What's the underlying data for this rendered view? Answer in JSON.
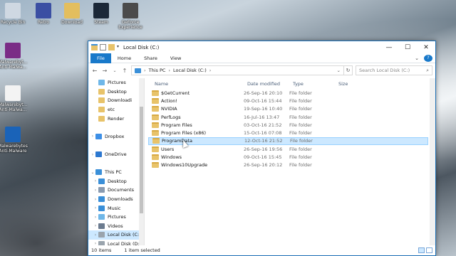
{
  "desktop": {
    "icons": [
      {
        "label": "Recycle Bin",
        "icon": "recycle-bin-icon",
        "color": "#cfd8e2"
      },
      {
        "label": "Retro",
        "icon": "retro-icon",
        "color": "#3b4fa3"
      },
      {
        "label": "Download",
        "icon": "folder-icon",
        "color": "#e3be5e"
      },
      {
        "label": "Steam",
        "icon": "steam-icon",
        "color": "#1b2838"
      },
      {
        "label": "GeForce Experience",
        "icon": "geforce-icon",
        "color": "#4b4b4b"
      },
      {
        "label": "Malwarebyt... Anti-Malwa...",
        "icon": "winrar-icon",
        "color": "#7a2c86"
      },
      {
        "label": "Malwarebyt... Anti-Malwa...",
        "icon": "document-icon",
        "color": "#f3f3f3"
      },
      {
        "label": "Malwarebytes Anti-Malware",
        "icon": "malwarebytes-icon",
        "color": "#1a63b8"
      }
    ]
  },
  "window": {
    "title": "Local Disk (C:)",
    "controls": {
      "minimize": "—",
      "maximize": "☐",
      "close": "✕"
    },
    "ribbon_tabs": [
      "File",
      "Home",
      "Share",
      "View"
    ],
    "address": {
      "segments": [
        "This PC",
        "Local Disk (C:)"
      ],
      "separator": "›"
    },
    "search_placeholder": "Search Local Disk (C:)",
    "columns": [
      "Name",
      "Date modified",
      "Type",
      "Size"
    ],
    "nav_items": [
      {
        "label": "Pictures",
        "icon": "pictures-folder-icon",
        "arrow": "",
        "indent": 2,
        "color": "#6fb7e8"
      },
      {
        "label": "Desktop",
        "icon": "folder-icon",
        "arrow": "",
        "indent": 2,
        "color": "#e8c36a"
      },
      {
        "label": "Downloadi",
        "icon": "folder-icon",
        "arrow": "",
        "indent": 2,
        "color": "#e8c36a"
      },
      {
        "label": "etc",
        "icon": "folder-icon",
        "arrow": "",
        "indent": 2,
        "color": "#e8c36a"
      },
      {
        "label": "Render",
        "icon": "folder-icon",
        "arrow": "",
        "indent": 2,
        "color": "#e8c36a"
      },
      {
        "label": "",
        "icon": "",
        "arrow": "",
        "indent": 0,
        "color": ""
      },
      {
        "label": "Dropbox",
        "icon": "dropbox-icon",
        "arrow": "›",
        "indent": 1,
        "color": "#3d8fe6"
      },
      {
        "label": "",
        "icon": "",
        "arrow": "",
        "indent": 0,
        "color": ""
      },
      {
        "label": "OneDrive",
        "icon": "onedrive-icon",
        "arrow": "›",
        "indent": 1,
        "color": "#2d78d0"
      },
      {
        "label": "",
        "icon": "",
        "arrow": "",
        "indent": 0,
        "color": ""
      },
      {
        "label": "This PC",
        "icon": "this-pc-icon",
        "arrow": "⌄",
        "indent": 1,
        "color": "#3a8fd8"
      },
      {
        "label": "Desktop",
        "icon": "desktop-folder-icon",
        "arrow": "›",
        "indent": 2,
        "color": "#3a8fd8"
      },
      {
        "label": "Documents",
        "icon": "documents-folder-icon",
        "arrow": "›",
        "indent": 2,
        "color": "#8a9bb0"
      },
      {
        "label": "Downloads",
        "icon": "downloads-folder-icon",
        "arrow": "›",
        "indent": 2,
        "color": "#3a8fd8"
      },
      {
        "label": "Music",
        "icon": "music-folder-icon",
        "arrow": "›",
        "indent": 2,
        "color": "#3a8fd8"
      },
      {
        "label": "Pictures",
        "icon": "pictures-folder-icon",
        "arrow": "›",
        "indent": 2,
        "color": "#6fb7e8"
      },
      {
        "label": "Videos",
        "icon": "videos-folder-icon",
        "arrow": "›",
        "indent": 2,
        "color": "#6b7b8f"
      },
      {
        "label": "Local Disk (C:)",
        "icon": "drive-icon",
        "arrow": "›",
        "indent": 2,
        "color": "#9aa4ad",
        "selected": true
      },
      {
        "label": "Local Disk (D:)",
        "icon": "drive-icon",
        "arrow": "›",
        "indent": 2,
        "color": "#9aa4ad"
      },
      {
        "label": "",
        "icon": "",
        "arrow": "",
        "indent": 0,
        "color": ""
      },
      {
        "label": "Network",
        "icon": "network-icon",
        "arrow": "›",
        "indent": 1,
        "color": "#3a8fd8"
      }
    ],
    "files": [
      {
        "name": "$GetCurrent",
        "date": "26-Sep-16 20:10",
        "type": "File folder"
      },
      {
        "name": "Action!",
        "date": "09-Oct-16 15:44",
        "type": "File folder"
      },
      {
        "name": "NVIDIA",
        "date": "19-Sep-16 10:40",
        "type": "File folder"
      },
      {
        "name": "PerfLogs",
        "date": "16-Jul-16 13:47",
        "type": "File folder"
      },
      {
        "name": "Program Files",
        "date": "03-Oct-16 21:52",
        "type": "File folder"
      },
      {
        "name": "Program Files (x86)",
        "date": "15-Oct-16 07:08",
        "type": "File folder"
      },
      {
        "name": "ProgramData",
        "date": "12-Oct-16 21:52",
        "type": "File folder",
        "selected": true
      },
      {
        "name": "Users",
        "date": "26-Sep-16 19:56",
        "type": "File folder"
      },
      {
        "name": "Windows",
        "date": "09-Oct-16 15:45",
        "type": "File folder"
      },
      {
        "name": "Windows10Upgrade",
        "date": "26-Sep-16 20:12",
        "type": "File folder"
      }
    ],
    "status": {
      "count": "10 items",
      "selected": "1 item selected"
    }
  }
}
